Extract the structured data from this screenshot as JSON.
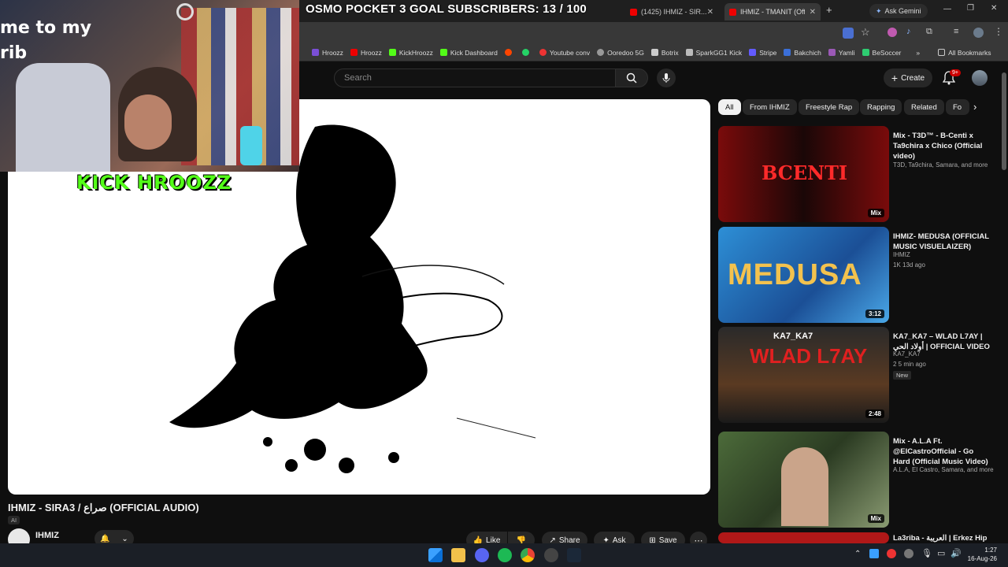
{
  "overlay": {
    "title": "OSMO POCKET 3 GOAL SUBSCRIBERS: 13 / 100",
    "kick_label": "KICK HROOZZ"
  },
  "tabs": [
    {
      "label": "(1425) IHMIZ - SIR..."
    },
    {
      "label": "IHMIZ - TMANIT (Offic..."
    }
  ],
  "ask_gemini": "Ask Gemini",
  "bookmarks": [
    "Hroozz",
    "Hroozz",
    "KickHroozz",
    "Kick Dashboard",
    "Youtube conv",
    "Ooredoo 5G",
    "Botrix",
    "SparkGG1 Kick",
    "Stripe",
    "Bakchich",
    "Yamli",
    "BeSoccer"
  ],
  "all_bookmarks": "All Bookmarks",
  "search": {
    "placeholder": "Search"
  },
  "create_label": "Create",
  "notif_count": "9+",
  "chips": [
    "All",
    "From IHMIZ",
    "Freestyle Rap",
    "Rapping",
    "Related",
    "Fo"
  ],
  "video": {
    "title": "IHMIZ - SIRA3 / صراع (OFFICIAL AUDIO)",
    "ai_tag": "AI",
    "channel": "IHMIZ"
  },
  "actions": {
    "like": "Like",
    "share": "Share",
    "ask": "Ask",
    "save": "Save"
  },
  "recommendations": [
    {
      "title": "Mix - T3D™ - B-Centi x Ta9chira x Chico (Official video)",
      "meta1": "T3D, Ta9chira, Samara, and more",
      "meta2": "",
      "badge": "Mix",
      "new": ""
    },
    {
      "title": "IHMIZ- MEDUSA (OFFICIAL MUSIC VISUELAIZER)",
      "meta1": "IHMIZ",
      "meta2": "1K  13d ago",
      "badge": "3:12",
      "new": ""
    },
    {
      "title": "KA7_KA7 – WLAD L7AY | أولاد الحي | OFFICIAL VIDEO",
      "meta1": "KA7_KA7",
      "meta2": "2  5 min ago",
      "badge": "2:48",
      "new": "New"
    },
    {
      "title": "Mix - A.L.A Ft. @ElCastroOfficial - Go Hard (Official Music Video)",
      "meta1": "A.L.A, El Castro, Samara, and more",
      "meta2": "",
      "badge": "Mix",
      "new": ""
    },
    {
      "title": "La3riba - العريبة | Erkez Hip",
      "meta1": "",
      "meta2": "",
      "badge": "",
      "new": ""
    }
  ],
  "thumb_text": {
    "bcenti": "BCENTI",
    "medusa": "MEDUSA",
    "ka7": "KA7_KA7",
    "wlad": "WLAD L7AY"
  },
  "clock": {
    "time": "1:27",
    "date": "16-Aug-26"
  }
}
